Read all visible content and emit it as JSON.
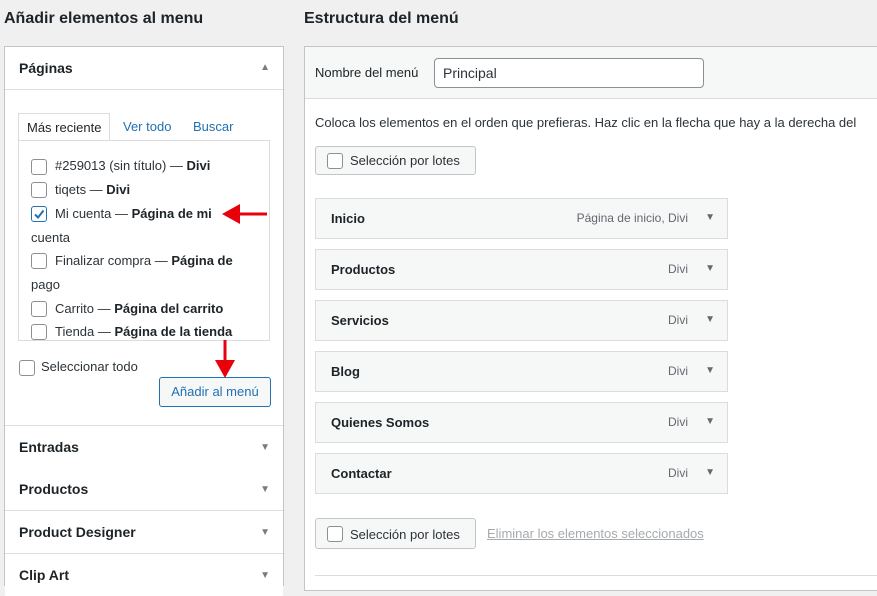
{
  "left": {
    "title": "Añadir elementos al menu",
    "pages_section": "Páginas",
    "tabs": [
      "Más reciente",
      "Ver todo",
      "Buscar"
    ],
    "pages": [
      {
        "line1": "#259013 (sin título) — ",
        "bold1": "Divi",
        "line2": "",
        "checked": false
      },
      {
        "line1": "tiqets — ",
        "bold1": "Divi",
        "line2": "",
        "checked": false
      },
      {
        "line1": "Mi cuenta — ",
        "bold1": "Página de mi",
        "line2": "cuenta",
        "checked": true
      },
      {
        "line1": "Finalizar compra — ",
        "bold1": "Página de",
        "line2": "pago",
        "checked": false
      },
      {
        "line1": "Carrito — ",
        "bold1": "Página del carrito",
        "line2": "",
        "checked": false
      },
      {
        "line1": "Tienda — ",
        "bold1": "Página de la tienda",
        "line2": "",
        "checked": false
      }
    ],
    "select_all": "Seleccionar todo",
    "add_button": "Añadir al menú",
    "sections": [
      "Entradas",
      "Productos",
      "Product Designer",
      "Clip Art"
    ]
  },
  "right": {
    "title": "Estructura del menú",
    "name_label": "Nombre del menú",
    "name_value": "Principal",
    "instructions": "Coloca los elementos en el orden que prefieras. Haz clic en la flecha que hay a la derecha del",
    "bulk_select": "Selección por lotes",
    "delete_selected": "Eliminar los elementos seleccionados",
    "items": [
      {
        "title": "Inicio",
        "meta": "Página de inicio, Divi"
      },
      {
        "title": "Productos",
        "meta": "Divi"
      },
      {
        "title": "Servicios",
        "meta": "Divi"
      },
      {
        "title": "Blog",
        "meta": "Divi"
      },
      {
        "title": "Quienes Somos",
        "meta": "Divi"
      },
      {
        "title": "Contactar",
        "meta": "Divi"
      }
    ]
  },
  "colors": {
    "link": "#2271b1",
    "annotation_arrow": "#e8000b"
  }
}
